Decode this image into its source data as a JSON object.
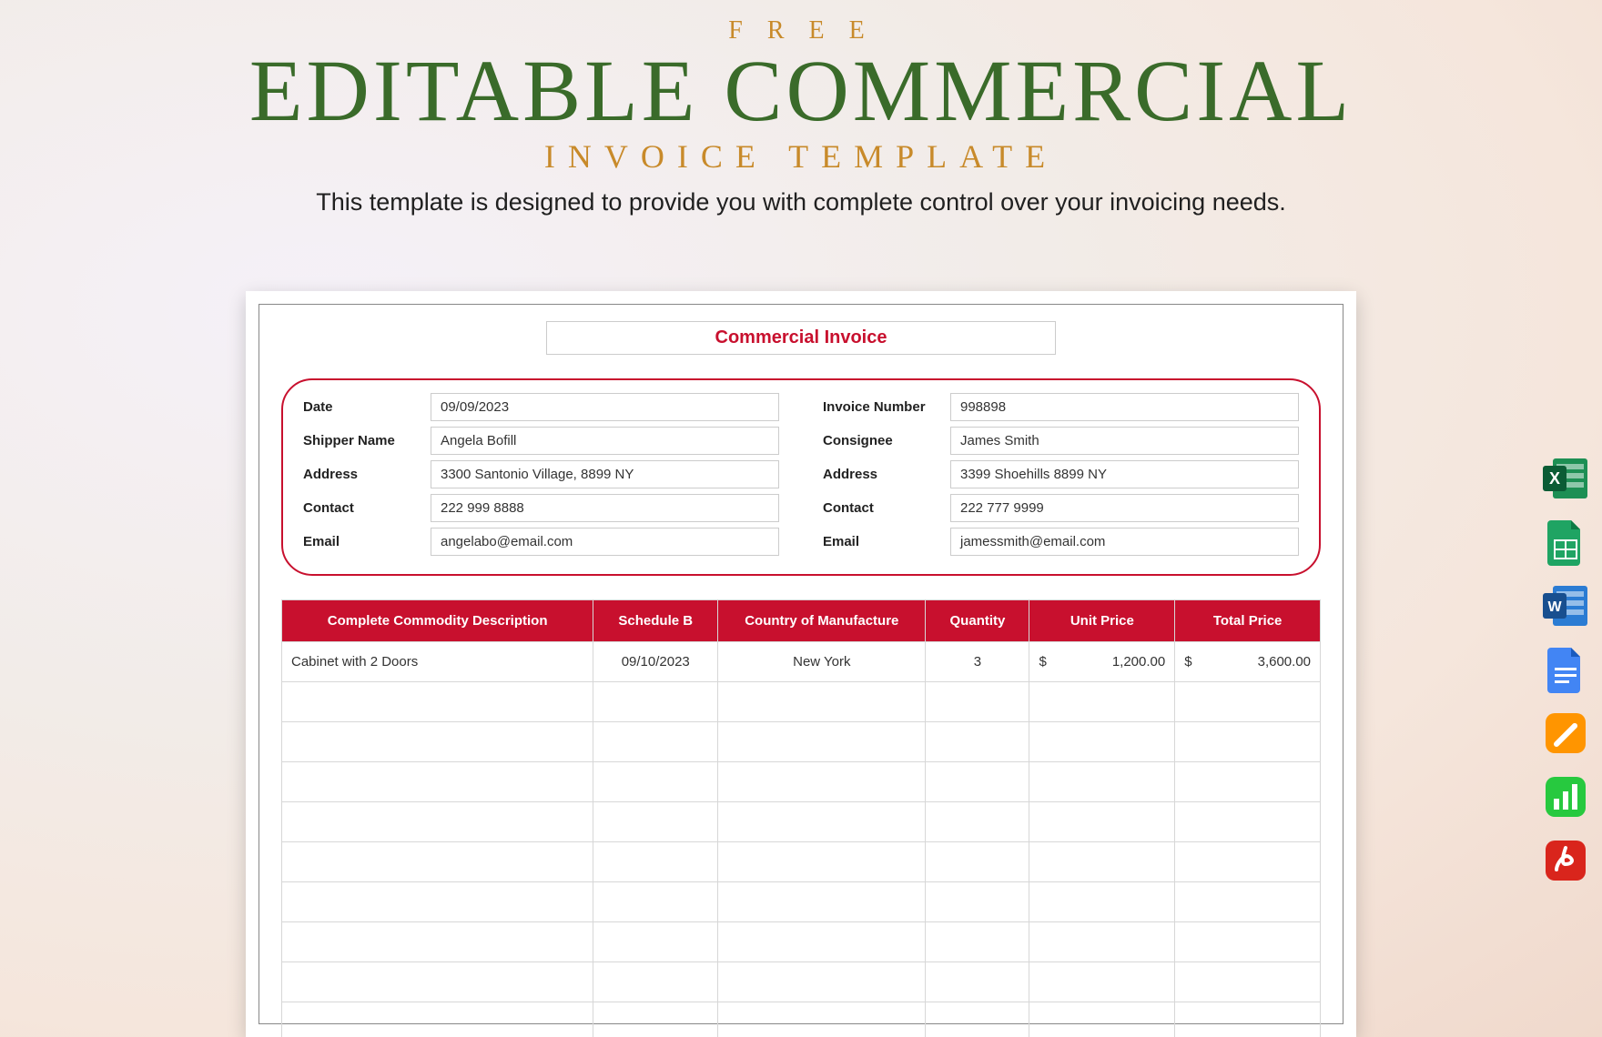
{
  "header": {
    "free": "F R E E",
    "title": "EDITABLE COMMERCIAL",
    "subtitle": "INVOICE TEMPLATE",
    "tagline": "This template is designed to provide you with complete control over your invoicing needs."
  },
  "invoice": {
    "title": "Commercial Invoice",
    "left": {
      "date_label": "Date",
      "date": "09/09/2023",
      "shipper_label": "Shipper Name",
      "shipper": "Angela Bofill",
      "address_label": "Address",
      "address": "3300 Santonio Village, 8899 NY",
      "contact_label": "Contact",
      "contact": "222 999 8888",
      "email_label": "Email",
      "email": "angelabo@email.com"
    },
    "right": {
      "invno_label": "Invoice Number",
      "invno": "998898",
      "consignee_label": "Consignee",
      "consignee": "James Smith",
      "address_label": "Address",
      "address": "3399 Shoehills 8899 NY",
      "contact_label": "Contact",
      "contact": "222 777 9999",
      "email_label": "Email",
      "email": "jamessmith@email.com"
    }
  },
  "table": {
    "headers": {
      "desc": "Complete Commodity Description",
      "sched": "Schedule B",
      "country": "Country of Manufacture",
      "qty": "Quantity",
      "unit": "Unit Price",
      "total": "Total Price"
    },
    "row1": {
      "desc": "Cabinet with 2 Doors",
      "sched": "09/10/2023",
      "country": "New York",
      "qty": "3",
      "unit_cur": "$",
      "unit_val": "1,200.00",
      "total_cur": "$",
      "total_val": "3,600.00"
    }
  },
  "icons": {
    "excel": "excel-icon",
    "sheets": "google-sheets-icon",
    "word": "word-icon",
    "docs": "google-docs-icon",
    "pages": "apple-pages-icon",
    "numbers": "apple-numbers-icon",
    "pdf": "pdf-icon"
  }
}
